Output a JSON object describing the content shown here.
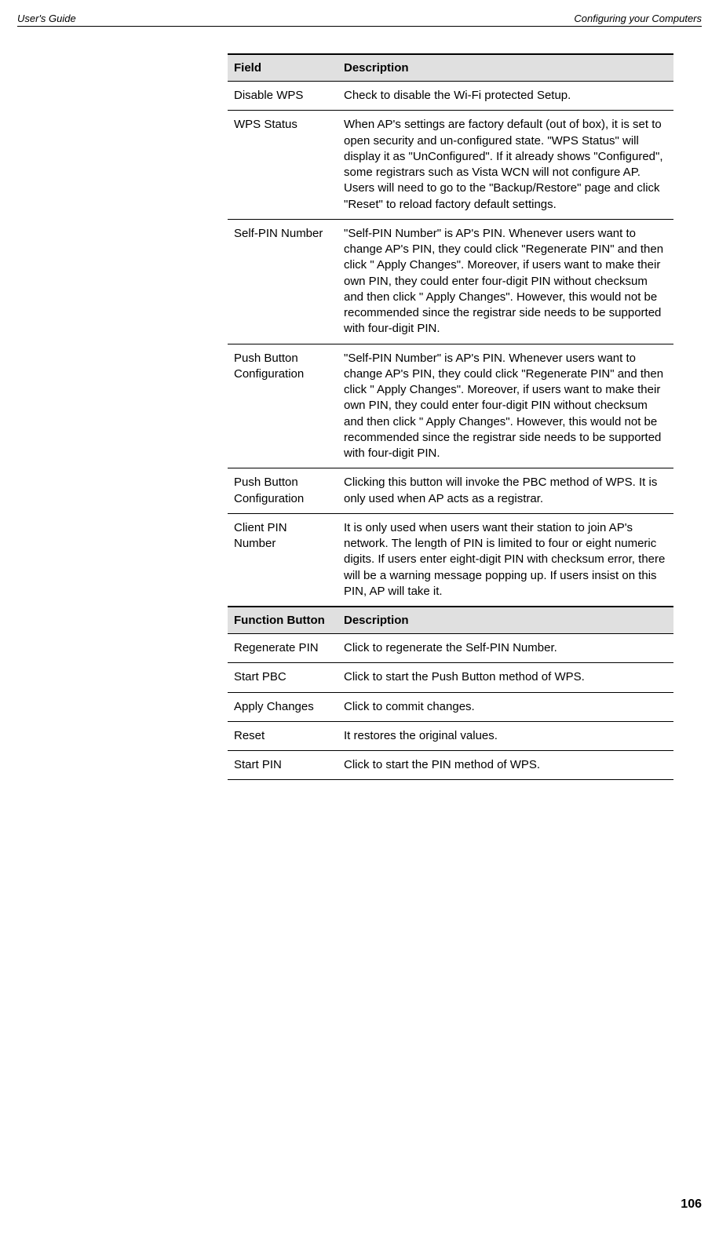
{
  "header": {
    "left": "User's Guide",
    "right": "Configuring your Computers"
  },
  "table1": {
    "col1": "Field",
    "col2": "Description",
    "rows": [
      {
        "field": "Disable WPS",
        "desc": "Check to disable the Wi-Fi protected Setup."
      },
      {
        "field": "WPS Status",
        "desc": "When AP's settings are factory default (out of box), it is set to open security and un-configured state. \"WPS Status\" will display it as \"UnConfigured\". If it already shows \"Configured\", some registrars such as Vista WCN will not configure AP. Users will need to go to the \"Backup/Restore\" page and click \"Reset\" to reload factory default settings."
      },
      {
        "field": "Self-PIN Number",
        "desc": "\"Self-PIN Number\" is AP's PIN. Whenever users want to change AP's PIN, they could click \"Regenerate PIN\" and then click \" Apply Changes\". Moreover, if users want to make their own PIN, they could enter four-digit PIN without checksum and then click \" Apply Changes\". However, this would not be recommended since the registrar side needs to be supported with four-digit PIN."
      },
      {
        "field": "Push Button Configuration",
        "desc": "\"Self-PIN Number\" is AP's PIN. Whenever users want to change AP's PIN, they could click \"Regenerate PIN\" and then click \" Apply Changes\". Moreover, if users want to make their own PIN, they could enter four-digit PIN without checksum and then click \" Apply Changes\". However, this would not be recommended since the registrar side needs to be supported with four-digit PIN."
      },
      {
        "field": "Push Button Configuration",
        "desc": "Clicking this button will invoke the PBC method of WPS. It is only used when AP acts as a registrar."
      },
      {
        "field": "Client PIN Number",
        "desc": "It is only used when users want their station to join AP's network. The length of PIN is limited to four or eight numeric digits. If users enter eight-digit PIN with checksum error, there will be a warning message popping up. If users insist on this PIN, AP will take it."
      }
    ]
  },
  "table2": {
    "col1": "Function Button",
    "col2": "Description",
    "rows": [
      {
        "field": "Regenerate PIN",
        "desc": "Click to regenerate the Self-PIN Number."
      },
      {
        "field": "Start PBC",
        "desc": "Click to start the Push Button method of WPS."
      },
      {
        "field": "Apply Changes",
        "desc": "Click to commit changes."
      },
      {
        "field": "Reset",
        "desc": "It restores the original values."
      },
      {
        "field": "Start PIN",
        "desc": "Click to start the PIN method of WPS."
      }
    ]
  },
  "pageNumber": "106"
}
